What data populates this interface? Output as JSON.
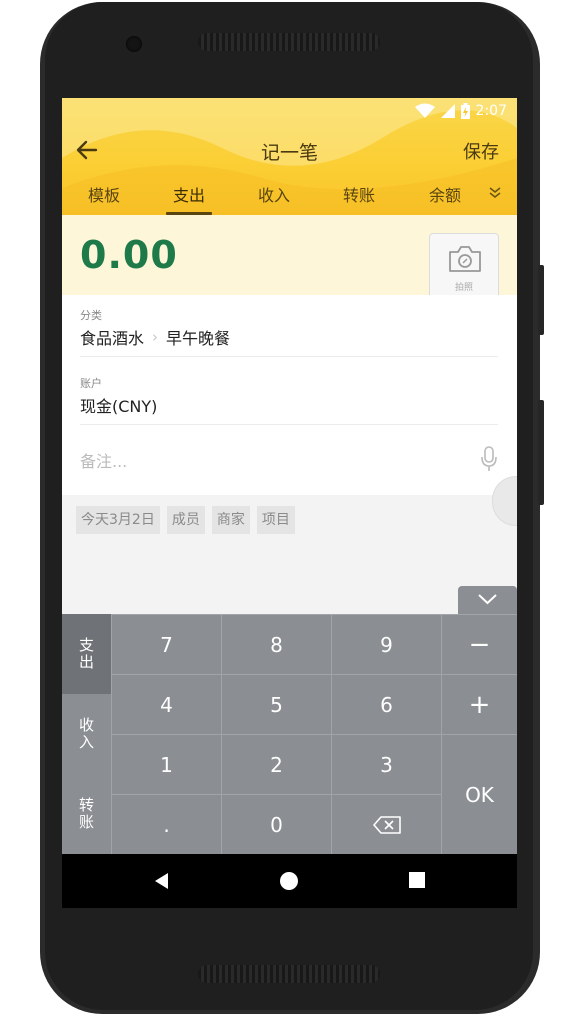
{
  "status_bar": {
    "time": "2:07"
  },
  "header": {
    "title": "记一笔",
    "save_label": "保存"
  },
  "tabs": [
    {
      "label": "模板"
    },
    {
      "label": "支出"
    },
    {
      "label": "收入"
    },
    {
      "label": "转账"
    },
    {
      "label": "余额"
    }
  ],
  "amount": "0.00",
  "photo_label": "拍照",
  "category": {
    "label": "分类",
    "primary": "食品酒水",
    "secondary": "早午晚餐"
  },
  "account": {
    "label": "账户",
    "value": "现金(CNY)"
  },
  "note": {
    "placeholder": "备注..."
  },
  "chips": [
    "今天3月2日",
    "成员",
    "商家",
    "项目"
  ],
  "keyboard": {
    "side": [
      "支出",
      "收入",
      "转账"
    ],
    "keys": [
      "7",
      "8",
      "9",
      "4",
      "5",
      "6",
      "1",
      "2",
      "3",
      ".",
      "0"
    ],
    "minus": "−",
    "plus": "+",
    "ok": "OK"
  },
  "colors": {
    "accent": "#fbcf35",
    "amount": "#1f7a4a",
    "keyboard": "#8b8e92"
  }
}
